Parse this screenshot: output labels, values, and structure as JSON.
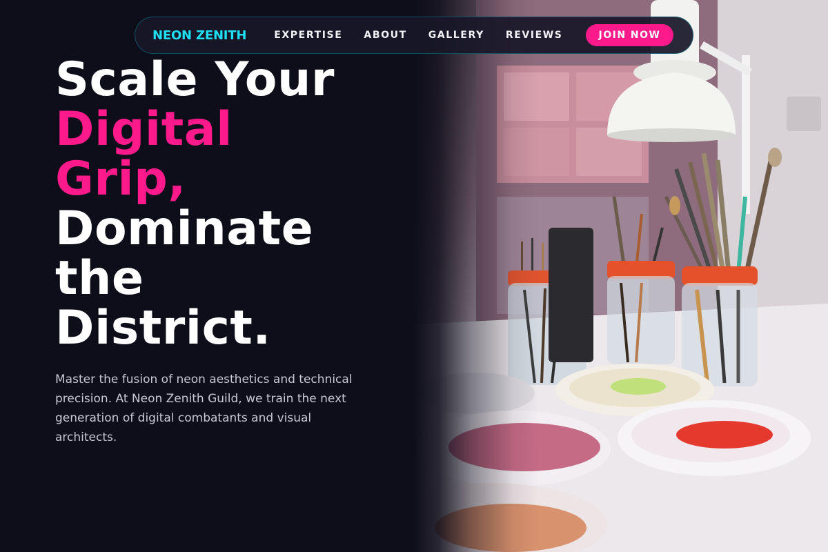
{
  "nav": {
    "logo": "NEON ZENITH",
    "links": [
      "EXPERTISE",
      "ABOUT",
      "GALLERY",
      "REVIEWS"
    ],
    "cta": "JOIN NOW"
  },
  "hero": {
    "headline_lines": [
      "Scale Your",
      "Digital",
      "Grip,",
      "Dominate",
      "the",
      "District."
    ],
    "subtitle": "Master the fusion of neon aesthetics and technical precision. At Neon Zenith Guild, we train the next generation of digital combatants and visual architects."
  },
  "image": {
    "subject": "paint brushes in jars and paint palettes"
  },
  "colors": {
    "background": "#0e0d1a",
    "accent_cyan": "#1fe0f2",
    "accent_pink": "#ff1a8c"
  }
}
